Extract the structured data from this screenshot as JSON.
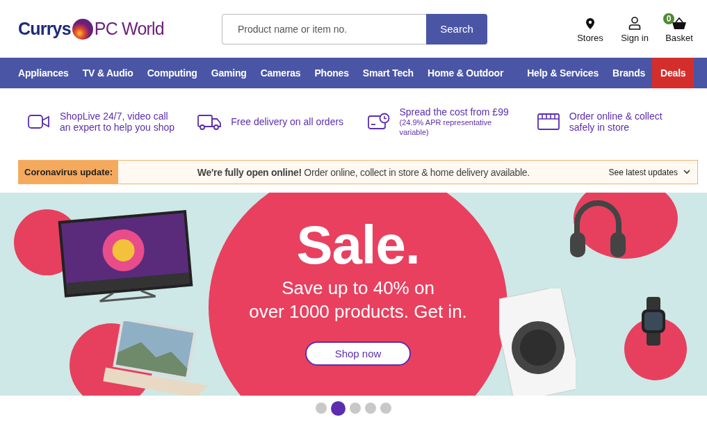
{
  "header": {
    "logo_left": "Currys",
    "logo_right": "PC World",
    "search": {
      "placeholder": "Product name or item no.",
      "button": "Search"
    },
    "actions": [
      {
        "kind": "stores",
        "label": "Stores"
      },
      {
        "kind": "account",
        "label": "Sign in"
      },
      {
        "kind": "basket",
        "label": "Basket",
        "count": "0"
      }
    ]
  },
  "nav": [
    {
      "label": "Appliances",
      "highlight": false
    },
    {
      "label": "TV & Audio",
      "highlight": false
    },
    {
      "label": "Computing",
      "highlight": false
    },
    {
      "label": "Gaming",
      "highlight": false
    },
    {
      "label": "Cameras",
      "highlight": false
    },
    {
      "label": "Phones",
      "highlight": false
    },
    {
      "label": "Smart Tech",
      "highlight": false
    },
    {
      "label": "Home & Outdoor",
      "highlight": false
    },
    {
      "label": "Help & Services",
      "highlight": false
    },
    {
      "label": "Brands",
      "highlight": false
    },
    {
      "label": "Deals",
      "highlight": true
    }
  ],
  "benefits": [
    {
      "kind": "video",
      "title": "ShopLive 24/7, video call an expert to help you shop"
    },
    {
      "kind": "truck",
      "title": "Free delivery on all orders"
    },
    {
      "kind": "card",
      "title": "Spread the cost from £99",
      "note": "(24.9% APR representative variable)"
    },
    {
      "kind": "store",
      "title": "Order online & collect safely in store"
    }
  ],
  "notice": {
    "label": "Coronavirus update:",
    "message": "**We're fully open online!** Order online, collect in store & home delivery available.",
    "link": "See latest updates"
  },
  "banner": {
    "headline": "Sale.",
    "lines": [
      "Save up to 40% on",
      "over 1000 products. Get in."
    ],
    "button": "Shop now"
  },
  "carousel_dots": [
    {
      "selected": false
    },
    {
      "selected": true
    },
    {
      "selected": false
    },
    {
      "selected": false
    },
    {
      "selected": false
    }
  ]
}
